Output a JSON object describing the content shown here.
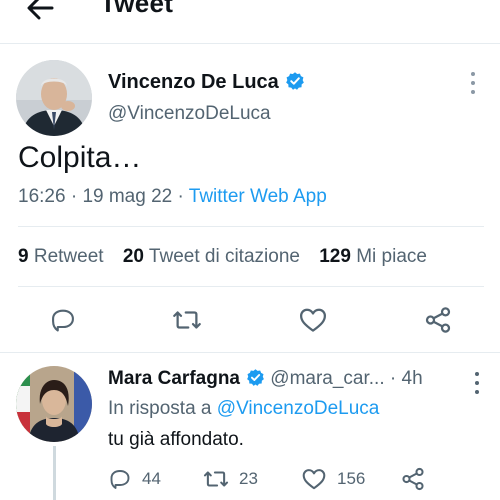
{
  "header": {
    "title": "Tweet"
  },
  "tweet": {
    "author_name": "Vincenzo De Luca",
    "author_handle": "@VincenzoDeLuca",
    "text": "Colpita…",
    "time": "16:26",
    "date": "19 mag 22",
    "separator": "·",
    "source": "Twitter Web App",
    "stats": {
      "retweets_count": "9",
      "retweets_label": "Retweet",
      "quotes_count": "20",
      "quotes_label": "Tweet di citazione",
      "likes_count": "129",
      "likes_label": "Mi piace"
    },
    "icons": [
      "reply-icon",
      "retweet-icon",
      "like-icon",
      "share-icon"
    ]
  },
  "reply": {
    "author_name": "Mara Carfagna",
    "author_handle": "@mara_car...",
    "separator": "·",
    "time": "4h",
    "replying_prefix": "In risposta a",
    "replying_mention": "@VincenzoDeLuca",
    "text": "tu già affondato.",
    "reply_count": "44",
    "retweet_count": "23",
    "like_count": "156"
  },
  "colors": {
    "accent": "#1d9bf0",
    "text_primary": "#0f1419",
    "text_secondary": "#536471",
    "divider": "#e6ecf0"
  }
}
